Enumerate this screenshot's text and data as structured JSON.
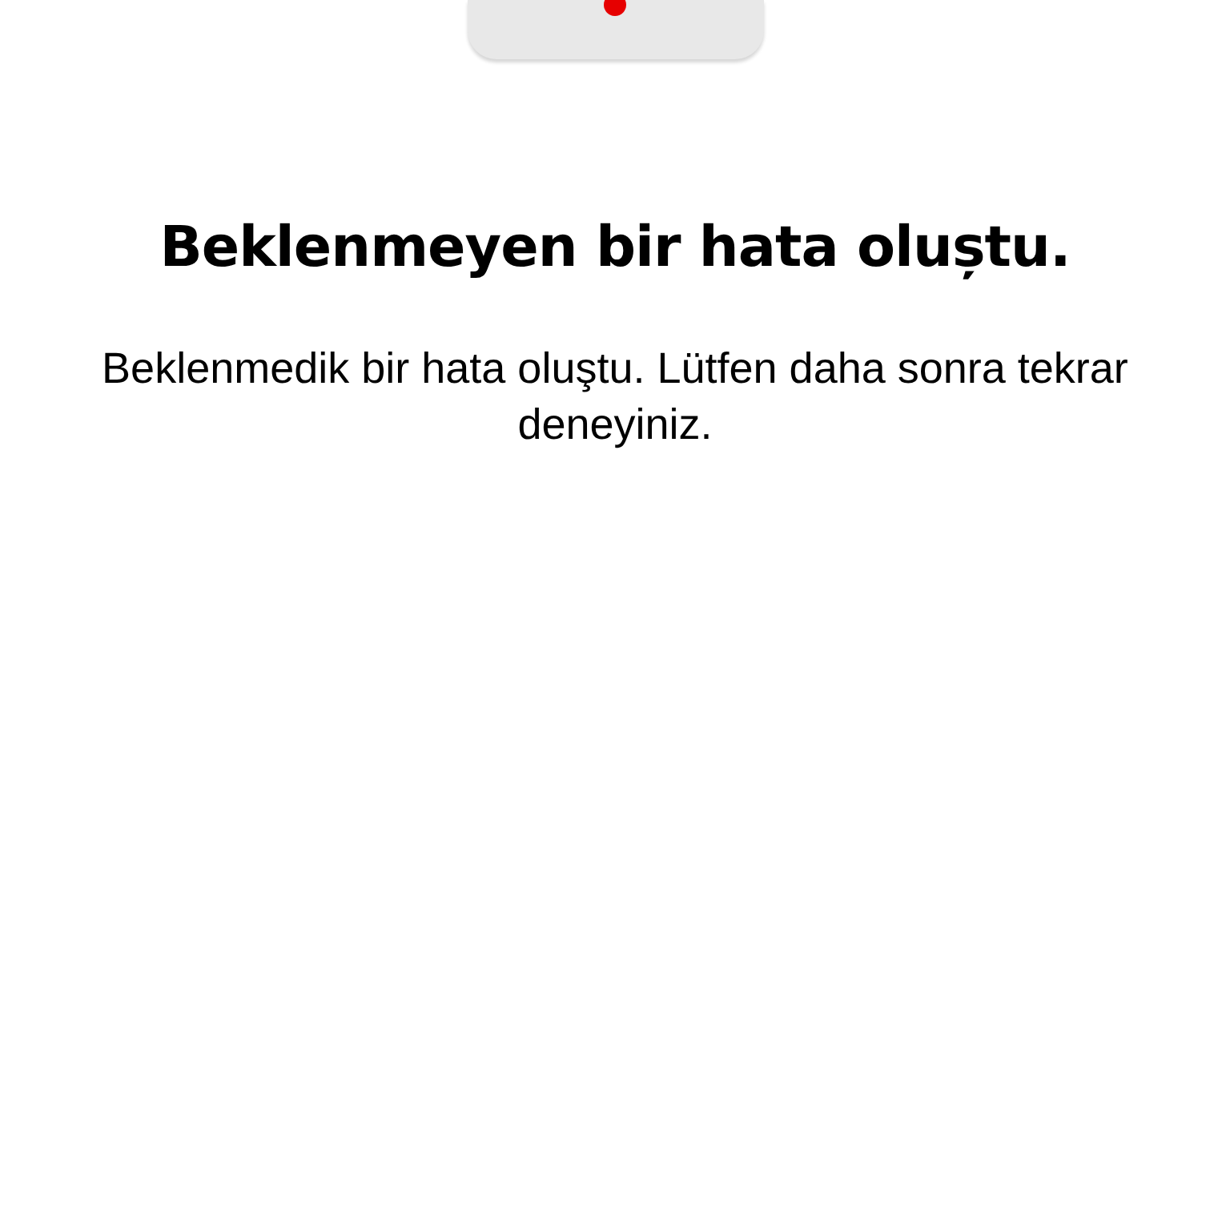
{
  "error": {
    "title": "Beklenmeyen bir hata oluștu.",
    "message": "Beklenmedik bir hata oluştu. Lütfen daha sonra tekrar deneyiniz."
  }
}
